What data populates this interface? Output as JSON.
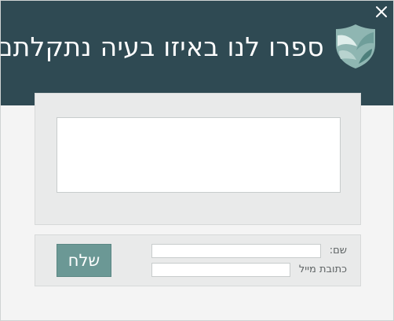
{
  "dialog": {
    "title": "ספרו לנו באיזו בעיה נתקלתם",
    "close_icon": "close-icon",
    "logo_icon": "shield-wing-logo"
  },
  "message": {
    "value": "",
    "placeholder": ""
  },
  "form": {
    "name_label": "שם:",
    "name_value": "",
    "email_label": "כתובת מייל",
    "email_value": "",
    "send_label": "שלח"
  },
  "colors": {
    "header_background": "#2f4a53",
    "send_button": "#6b9895",
    "panel_background": "#e9eaea",
    "dialog_background": "#f4f4f4",
    "logo_light": "#b8d3cf",
    "logo_dark": "#6f9e9a"
  }
}
